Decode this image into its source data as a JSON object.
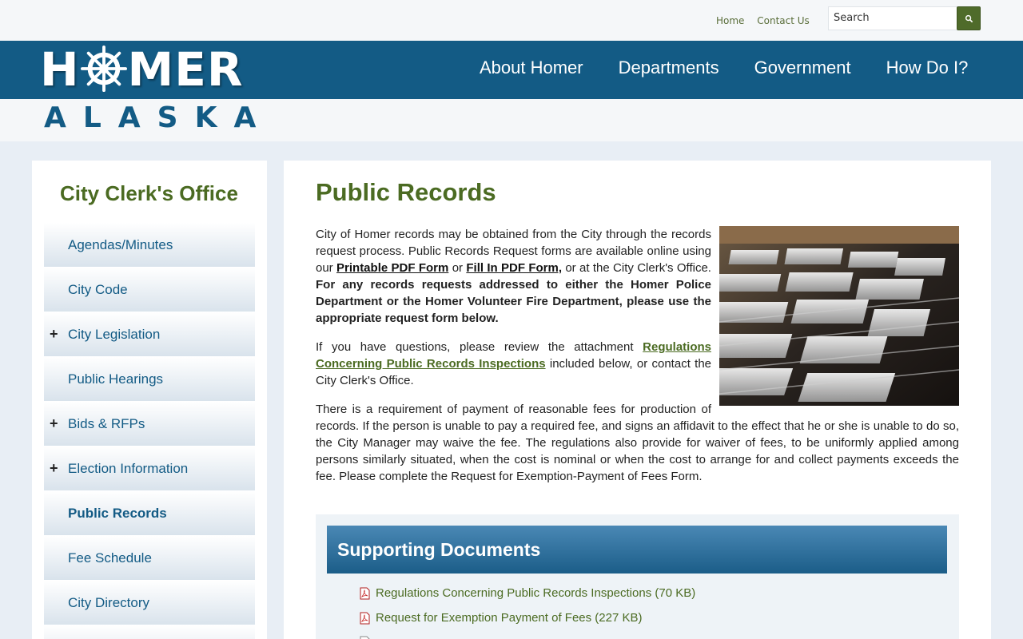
{
  "utility": {
    "home": "Home",
    "contact": "Contact Us",
    "search_placeholder": "Search"
  },
  "logo": {
    "homer_h": "H",
    "homer_rest": "MER",
    "alaska": "ALASKA"
  },
  "nav": [
    "About Homer",
    "Departments",
    "Government",
    "How Do I?"
  ],
  "sidebar": {
    "title": "City Clerk's Office",
    "items": [
      {
        "label": "Agendas/Minutes",
        "expand": false
      },
      {
        "label": "City Code",
        "expand": false
      },
      {
        "label": "City Legislation",
        "expand": true
      },
      {
        "label": "Public Hearings",
        "expand": false
      },
      {
        "label": "Bids & RFPs",
        "expand": true
      },
      {
        "label": "Election Information",
        "expand": true
      },
      {
        "label": "Public Records",
        "expand": false,
        "active": true
      },
      {
        "label": "Fee Schedule",
        "expand": false
      },
      {
        "label": "City Directory",
        "expand": false
      }
    ]
  },
  "content": {
    "title": "Public Records",
    "p1_a": "City of Homer records may be obtained from the City through the records request process.  Public Records Request forms are available online using our ",
    "p1_link1": "Printable PDF Form",
    "p1_or": " or ",
    "p1_link2": "Fill In PDF Form,",
    "p1_b": " or at the City Clerk's Office. ",
    "p1_bold": "For any records requests addressed to either the Homer Police Department or the Homer Volunteer Fire Department, please use the appropriate request form below.",
    "p2_a": "If you have questions, please review the attachment ",
    "p2_link": "Regulations Concerning Public Records Inspections",
    "p2_b": " included below, or contact the City Clerk's Office.",
    "p3": "There is a requirement of payment of reasonable fees for production of records. If the person is unable to pay a required fee, and signs an affidavit to the effect that he or she is unable to do so, the City Manager may waive the fee. The regulations also provide for waiver of fees, to be uniformly applied among persons similarly situated, when the cost is nominal or when the cost to arrange for and collect payments exceeds the fee. Please complete the Request for Exemption-Payment of Fees Form."
  },
  "docs": {
    "title": "Supporting Documents",
    "items": [
      "Regulations Concerning Public Records Inspections (70 KB)",
      "Request for Exemption Payment of Fees (227 KB)"
    ]
  },
  "colors": {
    "brand_blue": "#135b85",
    "brand_green": "#4b6b22"
  }
}
